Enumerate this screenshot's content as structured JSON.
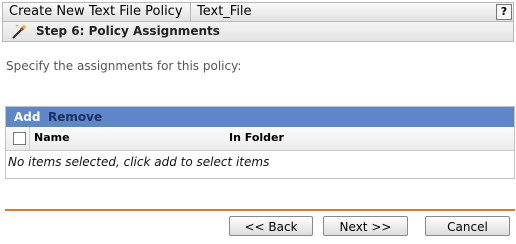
{
  "titlebar": {
    "title": "Create New Text File Policy",
    "policy_name": "Text_File",
    "help_label": "?"
  },
  "step": {
    "icon": "wand-icon",
    "label": "Step 6: Policy Assignments"
  },
  "instructions": "Specify the assignments for this policy:",
  "assignments": {
    "toolbar": {
      "add_label": "Add",
      "remove_label": "Remove"
    },
    "columns": [
      "Name",
      "In Folder"
    ],
    "empty_message": "No items selected, click add to select items"
  },
  "footer": {
    "back_label": "<< Back",
    "next_label": "Next >>",
    "cancel_label": "Cancel",
    "divider_color": "#d97b3d"
  },
  "colors": {
    "toolbar_bg": "#5e86c9",
    "add_text": "#ffffff",
    "remove_text": "#1c2f5e"
  }
}
